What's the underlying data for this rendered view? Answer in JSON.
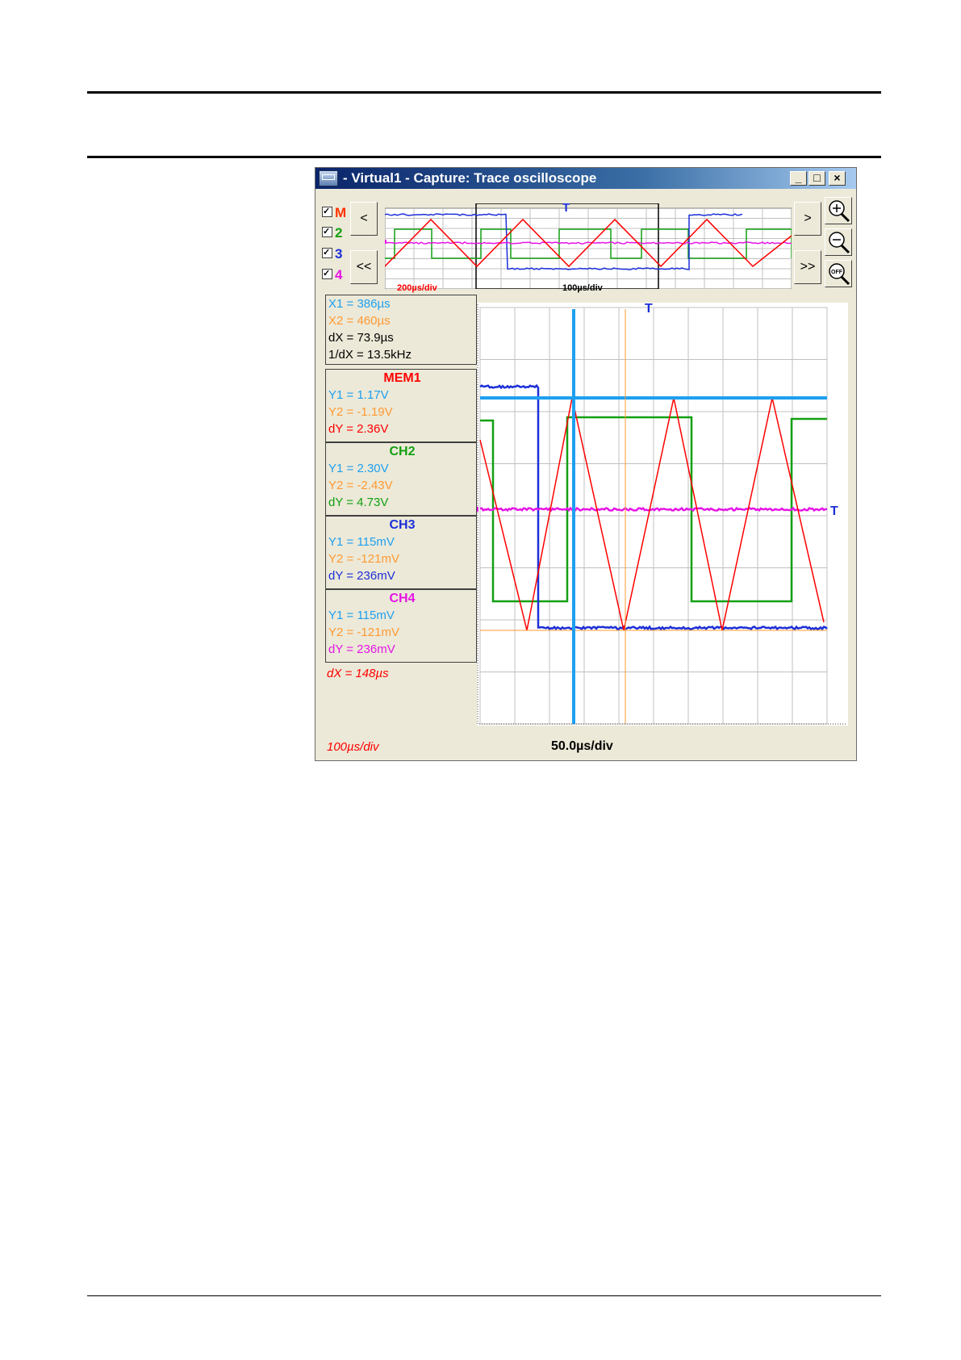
{
  "window": {
    "title": "- Virtual1 - Capture: Trace oscilloscope",
    "controls": {
      "minimize": "_",
      "maximize": "□",
      "close": "×"
    }
  },
  "channels": [
    {
      "label": "M",
      "color": "#ff3300",
      "checked": true
    },
    {
      "label": "2",
      "color": "#12a012",
      "checked": true
    },
    {
      "label": "3",
      "color": "#1c2fd8",
      "checked": true
    },
    {
      "label": "4",
      "color": "#e614e6",
      "checked": true
    }
  ],
  "nav": {
    "prev": "<",
    "first": "<<",
    "next": ">",
    "last": ">>"
  },
  "icons": {
    "zoom_in": "zoom-in-icon",
    "zoom_out": "zoom-out-icon",
    "zoom_off": "zoom-off-icon"
  },
  "zoom_off_text": "OFF",
  "overview": {
    "trigger": "T",
    "left_scale": "200µs/div",
    "zoom_scale": "100µs/div"
  },
  "cursor_box": {
    "x1": "X1 = 386µs",
    "x2": "X2 = 460µs",
    "dx": "dX = 73.9µs",
    "inv_dx": "1/dX = 13.5kHz"
  },
  "measure_boxes": [
    {
      "name": "MEM1",
      "y1": "Y1 = 1.17V",
      "y2": "Y2 = -1.19V",
      "dy": "dY = 2.36V",
      "color": "#ff0000"
    },
    {
      "name": "CH2",
      "y1": "Y1 = 2.30V",
      "y2": "Y2 = -2.43V",
      "dy": "dY = 4.73V",
      "color": "#12a012"
    },
    {
      "name": "CH3",
      "y1": "Y1 = 115mV",
      "y2": "Y2 = -121mV",
      "dy": "dY = 236mV",
      "color": "#1c2fd8"
    },
    {
      "name": "CH4",
      "y1": "Y1 = 115mV",
      "y2": "Y2 = -121mV",
      "dy": "dY = 236mV",
      "color": "#e614e6"
    }
  ],
  "mem_dx": "dX = 148µs",
  "main": {
    "trigger_top": "T",
    "trigger_right": "T",
    "mem_scale": "100µs/div",
    "timebase": "50.0µs/div"
  },
  "colors": {
    "cursor1": "#1ea0f0",
    "cursor2": "#ff9933",
    "grid": "#c0c0c0"
  }
}
